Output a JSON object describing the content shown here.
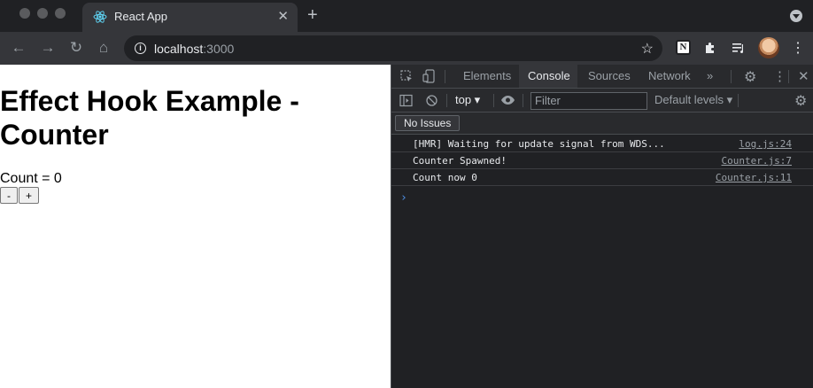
{
  "browser": {
    "tab_title": "React App",
    "tab_close": "✕",
    "new_tab": "+",
    "url_host": "localhost",
    "url_port": ":3000"
  },
  "page": {
    "heading": "Effect Hook Example - Counter",
    "count_text": "Count = 0",
    "decrement_label": "-",
    "increment_label": "+"
  },
  "devtools": {
    "tabs": [
      "Elements",
      "Console",
      "Sources",
      "Network"
    ],
    "more_tabs": "»",
    "context": "top ▾",
    "filter_placeholder": "Filter",
    "levels": "Default levels ▾",
    "issues": "No Issues",
    "logs": [
      {
        "message": "[HMR] Waiting for update signal from WDS...",
        "source": "log.js:24"
      },
      {
        "message": "Counter Spawned!",
        "source": "Counter.js:7"
      },
      {
        "message": "Count now 0",
        "source": "Counter.js:11"
      }
    ],
    "prompt": "›"
  },
  "colors": {
    "console_prompt": "#4d8ee3",
    "active_tab": "#35363a",
    "react_logo": "#61dafb"
  }
}
